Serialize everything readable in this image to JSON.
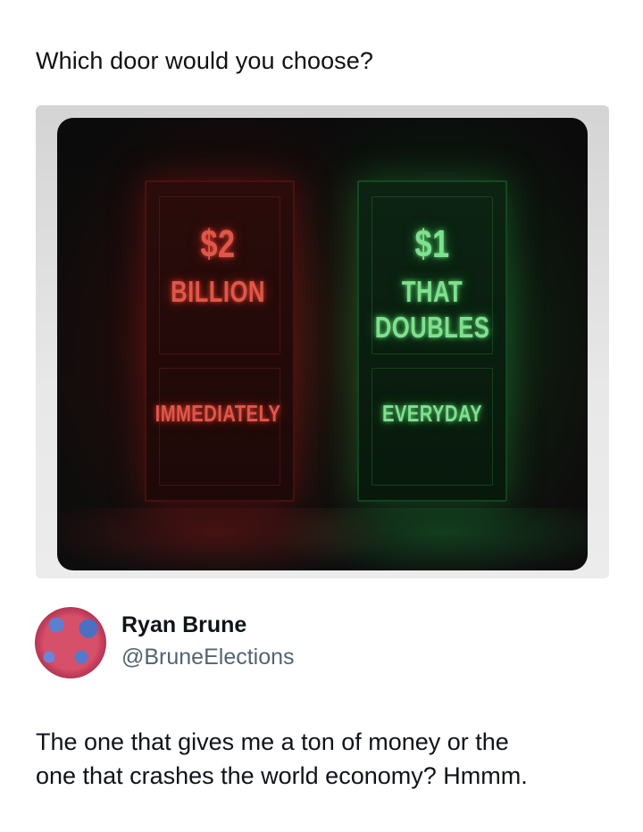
{
  "post": {
    "question": "Which door would you choose?"
  },
  "image": {
    "left_door": {
      "amount": "$2",
      "line1": "BILLION",
      "footer": "IMMEDIATELY",
      "glow_color": "#e0574a"
    },
    "right_door": {
      "amount": "$1",
      "line1": "THAT",
      "line2": "DOUBLES",
      "footer": "EVERYDAY",
      "glow_color": "#7fe08e"
    }
  },
  "reply": {
    "author_name": "Ryan Brune",
    "author_handle": "@BruneElections",
    "avatar_icon": "map-avatar-icon",
    "text_line1": "The one that gives me a ton of money or the",
    "text_line2": "one that crashes the world economy? Hmmm."
  }
}
